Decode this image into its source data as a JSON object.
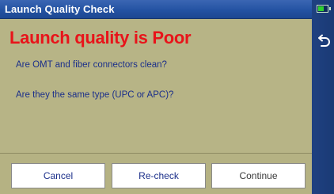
{
  "window": {
    "title": "Launch Quality Check"
  },
  "status": {
    "battery_icon": "battery-icon",
    "battery_color": "#2fd12f"
  },
  "nav": {
    "back_icon": "back-arrow-icon"
  },
  "dialog": {
    "heading": "Launch quality is Poor",
    "heading_color": "#e8141a",
    "question_1": "Are OMT and fiber connectors clean?",
    "question_2": "Are they the same type (UPC or APC)?"
  },
  "buttons": {
    "cancel": "Cancel",
    "recheck": "Re-check",
    "continue": "Continue"
  },
  "colors": {
    "title_bar": "#2453a3",
    "panel_bg": "#b7b486",
    "side_panel": "#1e3f7a",
    "question_text": "#1b2f8a"
  }
}
